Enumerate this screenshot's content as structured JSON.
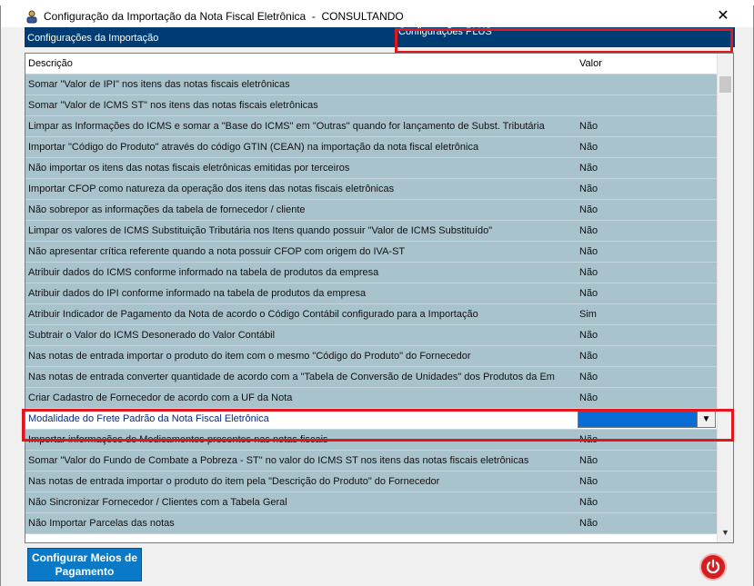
{
  "window": {
    "title": "Configuração da Importação da Nota Fiscal Eletrônica",
    "mode": "CONSULTANDO",
    "close_glyph": "✕"
  },
  "tabs": [
    {
      "label": "Configurações da Importação"
    },
    {
      "label": "Configurações PLUS"
    }
  ],
  "grid": {
    "headers": {
      "description": "Descrição",
      "value": "Valor"
    },
    "rows": [
      {
        "description": "Somar \"Valor de IPI\" nos itens das notas fiscais eletrônicas",
        "value": ""
      },
      {
        "description": "Somar \"Valor de ICMS ST\" nos itens das notas fiscais eletrônicas",
        "value": ""
      },
      {
        "description": "Limpar as Informações do ICMS e somar a \"Base do ICMS\" em \"Outras\" quando for lançamento de Subst. Tributária",
        "value": "Não"
      },
      {
        "description": "Importar \"Código do Produto\" através do código GTIN (CEAN) na importação da nota fiscal eletrônica",
        "value": "Não"
      },
      {
        "description": "Não importar os itens das notas fiscais eletrônicas emitidas por terceiros",
        "value": "Não"
      },
      {
        "description": "Importar CFOP como natureza da operação dos itens das notas fiscais eletrônicas",
        "value": "Não"
      },
      {
        "description": "Não sobrepor as informações da tabela de fornecedor / cliente",
        "value": "Não"
      },
      {
        "description": "Limpar os valores de ICMS Substituição Tributária nos Itens quando possuir \"Valor de ICMS Substituído\"",
        "value": "Não"
      },
      {
        "description": "Não apresentar crítica referente quando a nota possuir CFOP com origem do IVA-ST",
        "value": "Não"
      },
      {
        "description": "Atribuir dados do ICMS conforme informado na tabela de produtos da empresa",
        "value": "Não"
      },
      {
        "description": "Atribuir dados do IPI conforme informado na tabela de produtos da empresa",
        "value": "Não"
      },
      {
        "description": "Atribuir Indicador de Pagamento da Nota de acordo o Código Contábil configurado para a Importação",
        "value": "Sim"
      },
      {
        "description": "Subtrair o Valor do ICMS Desonerado do Valor Contábil",
        "value": "Não"
      },
      {
        "description": "Nas notas de entrada importar o produto do item com o mesmo \"Código do Produto\" do Fornecedor",
        "value": "Não"
      },
      {
        "description": "Nas notas de entrada converter quantidade de acordo com a \"Tabela de Conversão de Unidades\" dos Produtos da Em",
        "value": "Não"
      },
      {
        "description": "Criar Cadastro de Fornecedor de acordo com a UF da Nota",
        "value": "Não"
      },
      {
        "description": "Modalidade do Frete Padrão da Nota Fiscal Eletrônica",
        "value": "",
        "selected": true
      },
      {
        "description": "Importar informações de Medicamentos presentes nas notas fiscais",
        "value": "Não"
      },
      {
        "description": "Somar \"Valor do Fundo de Combate a Pobreza - ST\" no valor do ICMS ST nos itens das notas fiscais eletrônicas",
        "value": "Não"
      },
      {
        "description": "Nas notas de entrada importar o produto do item pela \"Descrição do Produto\" do Fornecedor",
        "value": "Não"
      },
      {
        "description": "Não Sincronizar Fornecedor / Clientes com a Tabela Geral",
        "value": "Não"
      },
      {
        "description": "Não Importar Parcelas das notas",
        "value": "Não"
      }
    ]
  },
  "buttons": {
    "payment_line1": "Configurar Meios de",
    "payment_line2": "Pagamento"
  },
  "icons": {
    "title": "user-icon",
    "close": "close-icon",
    "dropdown": "chevron-down-icon",
    "exit": "power-icon"
  },
  "colors": {
    "tab_bg": "#003c74",
    "row_bg": "#a9c3cd",
    "highlight": "#e3161d",
    "button_bg": "#0a7ac8",
    "power_bg": "#d31f1f"
  }
}
